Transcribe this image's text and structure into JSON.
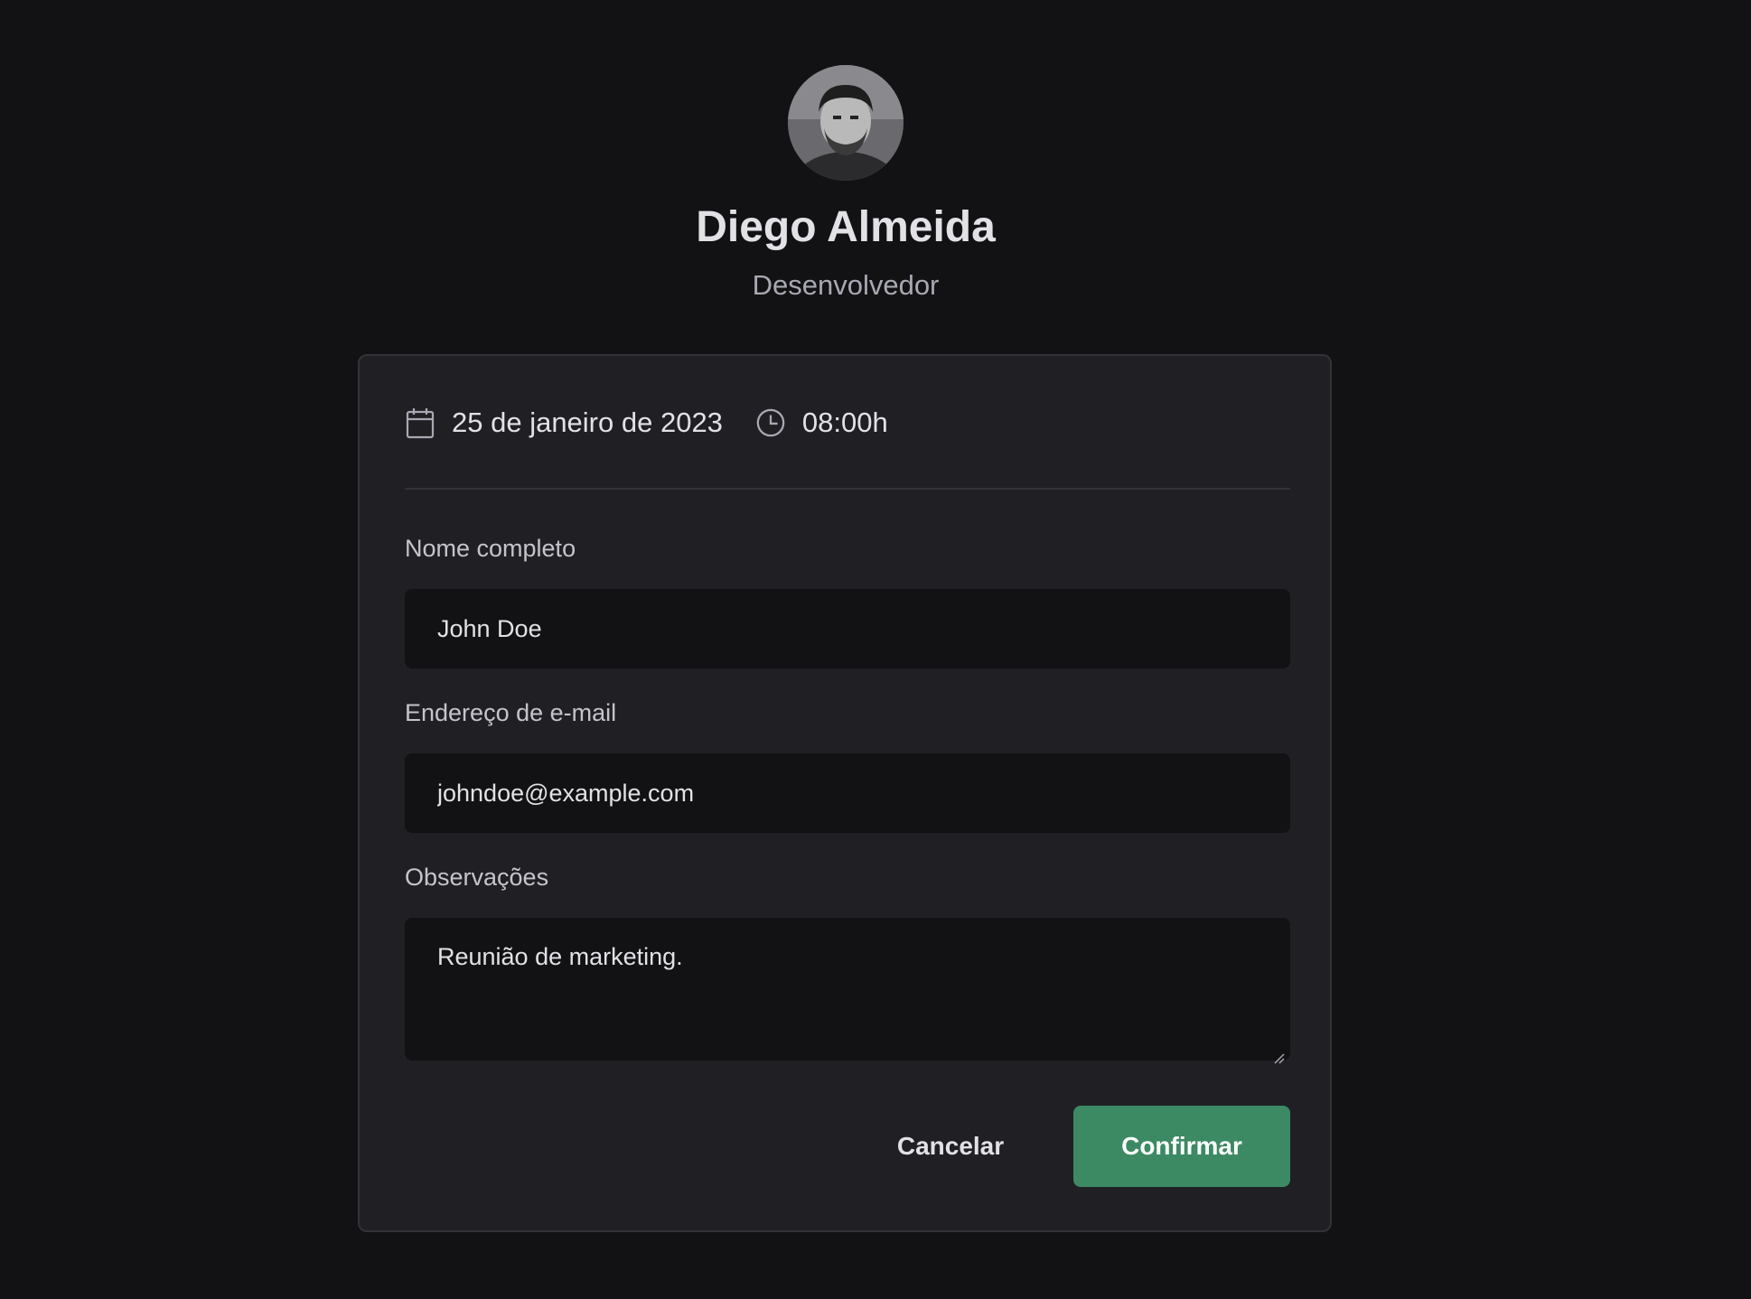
{
  "profile": {
    "name": "Diego Almeida",
    "role": "Desenvolvedor"
  },
  "appointment": {
    "date": "25 de janeiro de 2023",
    "time": "08:00h"
  },
  "form": {
    "name_label": "Nome completo",
    "name_value": "John Doe",
    "email_label": "Endereço de e-mail",
    "email_value": "johndoe@example.com",
    "notes_label": "Observações",
    "notes_value": "Reunião de marketing."
  },
  "actions": {
    "cancel_label": "Cancelar",
    "confirm_label": "Confirmar"
  },
  "colors": {
    "background": "#121214",
    "card": "#202024",
    "accent": "#3b8a64"
  }
}
